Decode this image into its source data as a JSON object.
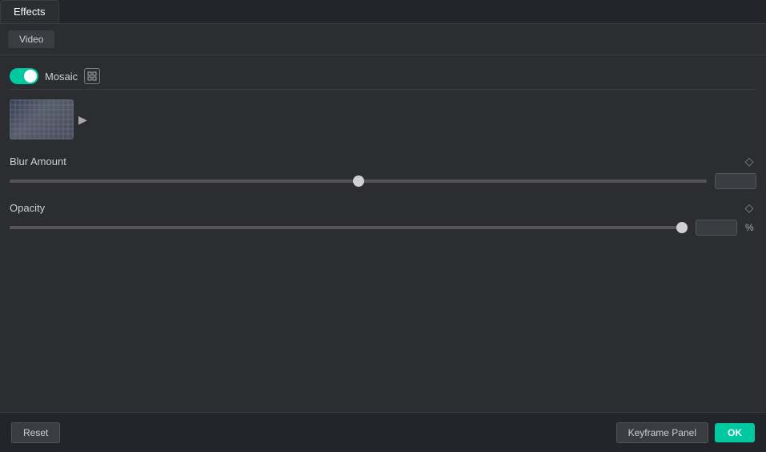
{
  "tabs": [
    {
      "id": "effects",
      "label": "Effects",
      "active": true
    }
  ],
  "subTabs": [
    {
      "id": "video",
      "label": "Video",
      "active": true
    }
  ],
  "mosaic": {
    "label": "Mosaic",
    "enabled": true
  },
  "thumbnail": {
    "arrowLabel": "▶"
  },
  "blurAmount": {
    "label": "Blur Amount",
    "value": 50,
    "percent": 50,
    "diamondLabel": "◇"
  },
  "opacity": {
    "label": "Opacity",
    "value": 100,
    "percent": 100,
    "unit": "%",
    "diamondLabel": "◇"
  },
  "footer": {
    "resetLabel": "Reset",
    "keyframePanelLabel": "Keyframe Panel",
    "okLabel": "OK"
  },
  "colors": {
    "toggleOn": "#00c8a0",
    "okBtn": "#00c8a0"
  }
}
